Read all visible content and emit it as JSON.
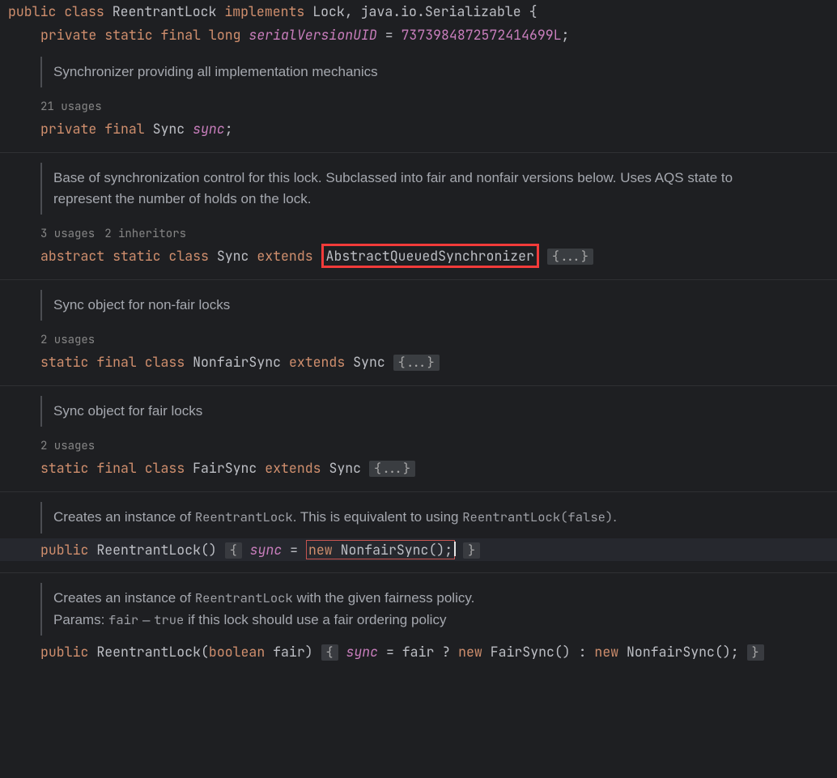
{
  "code": {
    "l1": {
      "p": "public ",
      "c": "class ",
      "name": "ReentrantLock ",
      "impl": "implements ",
      "iface": "Lock",
      "comma": ", ",
      "pkg": "java.io.Serializable ",
      "brace": "{"
    },
    "l2": {
      "priv": "private ",
      "stat": "static ",
      "fin": "final ",
      "long": "long ",
      "field": "serialVersionUID",
      "eq": " = ",
      "val": "7373984872572414699L",
      "semi": ";"
    },
    "doc1": "Synchronizer providing all implementation mechanics",
    "hint1": {
      "u": "21 usages"
    },
    "l3": {
      "priv": "private ",
      "fin": "final ",
      "type": "Sync ",
      "name": "sync",
      "semi": ";"
    },
    "doc2": "Base of synchronization control for this lock. Subclassed into fair and nonfair versions below. Uses AQS state to represent the number of holds on the lock.",
    "hint2": {
      "u": "3 usages",
      "i": "2 inheritors"
    },
    "l4": {
      "abs": "abstract ",
      "stat": "static ",
      "cls": "class ",
      "name": "Sync ",
      "ext": "extends",
      "sp": " ",
      "sup": "AbstractQueuedSynchronizer",
      "fold": "{...}"
    },
    "doc3": "Sync object for non-fair locks",
    "hint3": {
      "u": "2 usages"
    },
    "l5": {
      "stat": "static ",
      "fin": "final ",
      "cls": "class ",
      "name": "NonfairSync ",
      "ext": "extends ",
      "sup": "Sync ",
      "fold": "{...}"
    },
    "doc4": "Sync object for fair locks",
    "hint4": {
      "u": "2 usages"
    },
    "l6": {
      "stat": "static ",
      "fin": "final ",
      "cls": "class ",
      "name": "FairSync ",
      "ext": "extends ",
      "sup": "Sync ",
      "fold": "{...}"
    },
    "doc5": {
      "a": "Creates an instance of ",
      "b": "ReentrantLock",
      "c": ". This is equivalent to using ",
      "d": "ReentrantLock(false)",
      "e": "."
    },
    "l7": {
      "pub": "public ",
      "name": "ReentrantLock",
      "paren": "() ",
      "ob": "{",
      "sp": " ",
      "sync": "sync",
      "eq": " = ",
      "new": "new ",
      "ctor": "NonfairSync",
      "p2": "();",
      "cb": "}"
    },
    "doc6": {
      "a": "Creates an instance of ",
      "b": "ReentrantLock",
      "c": " with the given fairness policy.",
      "p": " Params: ",
      "fair": "fair",
      "dash": " – ",
      "tru": "true",
      "rest": " if this lock should use a fair ordering policy"
    },
    "l8": {
      "pub": "public ",
      "name": "ReentrantLock",
      "op": "(",
      "bool": "boolean ",
      "arg": "fair",
      "cp": ") ",
      "ob": "{",
      "sp": " ",
      "sync": "sync",
      "eq": " = ",
      "fair": "fair ",
      "q": "? ",
      "new1": "new ",
      "c1": "FairSync",
      "p1": "() ",
      "colon": ": ",
      "new2": "new ",
      "c2": "NonfairSync",
      "p2": "(); ",
      "cb": "}"
    }
  }
}
